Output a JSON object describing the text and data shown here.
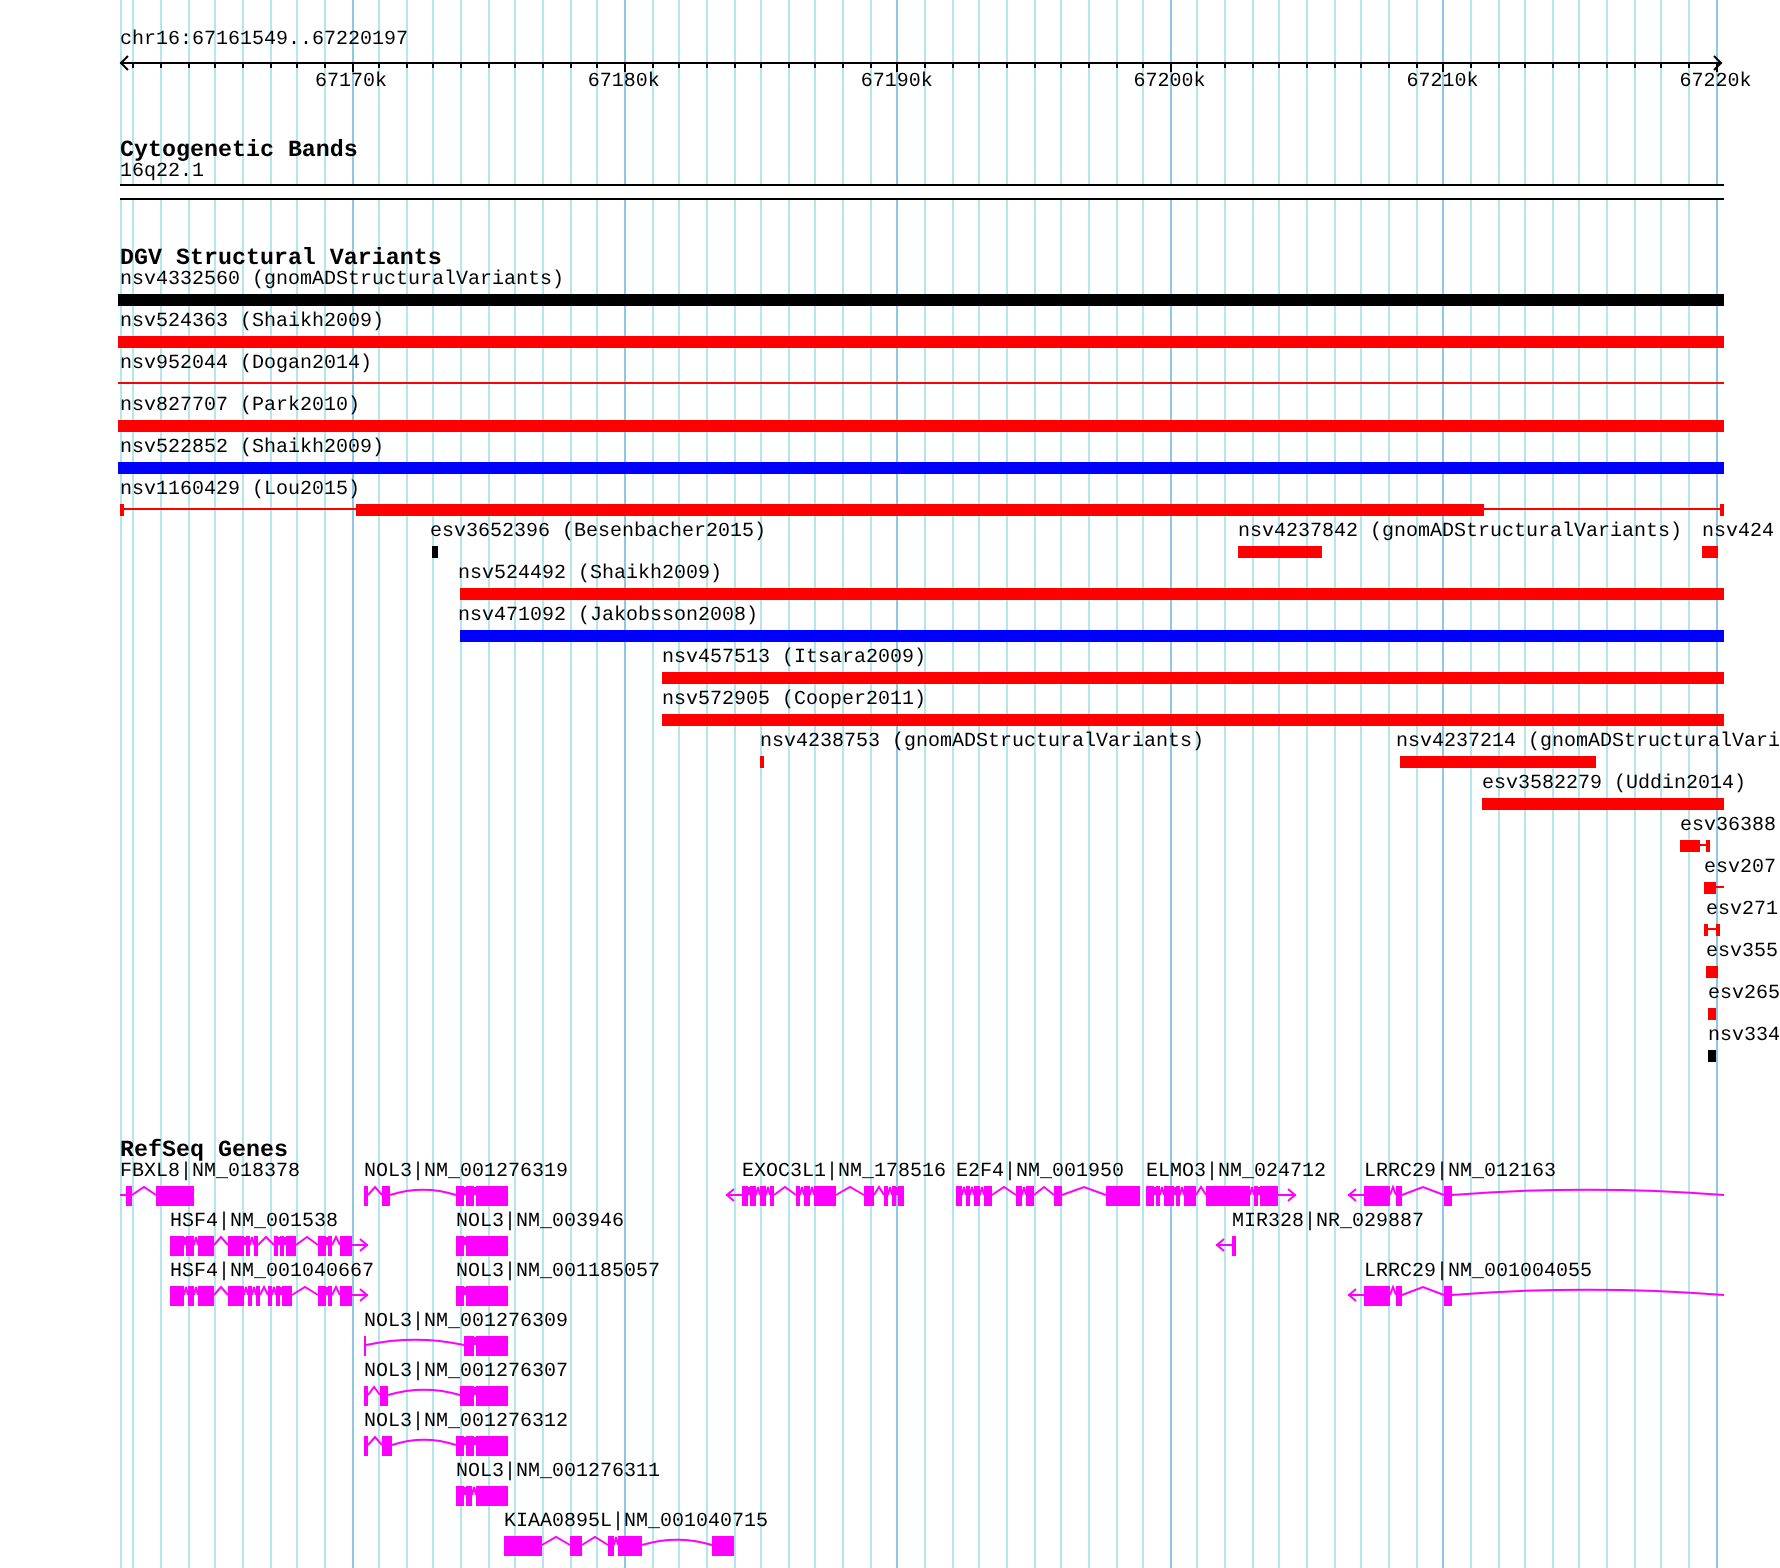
{
  "ruler": {
    "range": "chr16:67161549..67220197",
    "ticks": [
      "67170k",
      "67180k",
      "67190k",
      "67200k",
      "67210k",
      "67220k"
    ]
  },
  "cytogenetic_bands": {
    "title": "Cytogenetic Bands",
    "bands": [
      {
        "label": "16q22.1"
      }
    ]
  },
  "dgv_structural_variants": {
    "title": "DGV Structural Variants",
    "features": [
      {
        "label": "nsv4332560 (gnomADStructuralVariants)",
        "color": "#000000",
        "kind": "bar"
      },
      {
        "label": "nsv524363 (Shaikh2009)",
        "color": "#ff0000",
        "kind": "bar"
      },
      {
        "label": "nsv952044 (Dogan2014)",
        "color": "#ff0000",
        "kind": "line"
      },
      {
        "label": "nsv827707 (Park2010)",
        "color": "#ff0000",
        "kind": "bar"
      },
      {
        "label": "nsv522852 (Shaikh2009)",
        "color": "#0000ff",
        "kind": "bar"
      },
      {
        "label": "nsv1160429 (Lou2015)",
        "color": "#ff0000",
        "kind": "split"
      },
      {
        "label": "esv3652396 (Besenbacher2015)",
        "color": "#000000",
        "kind": "bar"
      },
      {
        "label": "nsv4237842 (gnomADStructuralVariants)",
        "color": "#ff0000",
        "kind": "bar"
      },
      {
        "label": "nsv424",
        "color": "#ff0000",
        "kind": "bar"
      },
      {
        "label": "nsv524492 (Shaikh2009)",
        "color": "#ff0000",
        "kind": "bar"
      },
      {
        "label": "nsv471092 (Jakobsson2008)",
        "color": "#0000ff",
        "kind": "bar"
      },
      {
        "label": "nsv457513 (Itsara2009)",
        "color": "#ff0000",
        "kind": "bar"
      },
      {
        "label": "nsv572905 (Cooper2011)",
        "color": "#ff0000",
        "kind": "bar"
      },
      {
        "label": "nsv4238753 (gnomADStructuralVariants)",
        "color": "#ff0000",
        "kind": "bar"
      },
      {
        "label": "nsv4237214 (gnomADStructuralVari",
        "color": "#ff0000",
        "kind": "bar"
      },
      {
        "label": "esv3582279 (Uddin2014)",
        "color": "#ff0000",
        "kind": "bar"
      },
      {
        "label": "esv36388",
        "color": "#ff0000",
        "kind": "split"
      },
      {
        "label": "esv207",
        "color": "#ff0000",
        "kind": "split"
      },
      {
        "label": "esv271",
        "color": "#ff0000",
        "kind": "split"
      },
      {
        "label": "esv355",
        "color": "#ff0000",
        "kind": "bar"
      },
      {
        "label": "esv265",
        "color": "#ff0000",
        "kind": "bar"
      },
      {
        "label": "nsv334",
        "color": "#000000",
        "kind": "bar"
      }
    ]
  },
  "refseq_genes": {
    "title": "RefSeq Genes",
    "genes": [
      {
        "label": "FBXL8|NM_018378",
        "kind": "plain"
      },
      {
        "label": "NOL3|NM_001276319",
        "kind": "plain"
      },
      {
        "label": "EXOC3L1|NM_178516",
        "kind": "reverse"
      },
      {
        "label": "E2F4|NM_001950",
        "kind": "plain"
      },
      {
        "label": "ELMO3|NM_024712",
        "kind": "forward"
      },
      {
        "label": "LRRC29|NM_012163",
        "kind": "reverse"
      },
      {
        "label": "HSF4|NM_001538",
        "kind": "forward"
      },
      {
        "label": "NOL3|NM_003946",
        "kind": "plain"
      },
      {
        "label": "MIR328|NR_029887",
        "kind": "reverse"
      },
      {
        "label": "HSF4|NM_001040667",
        "kind": "forward"
      },
      {
        "label": "NOL3|NM_001185057",
        "kind": "plain"
      },
      {
        "label": "LRRC29|NM_001004055",
        "kind": "reverse"
      },
      {
        "label": "NOL3|NM_001276309",
        "kind": "plain"
      },
      {
        "label": "NOL3|NM_001276307",
        "kind": "plain"
      },
      {
        "label": "NOL3|NM_001276312",
        "kind": "plain"
      },
      {
        "label": "NOL3|NM_001276311",
        "kind": "plain"
      },
      {
        "label": "KIAA0895L|NM_001040715",
        "kind": "plain"
      }
    ]
  }
}
